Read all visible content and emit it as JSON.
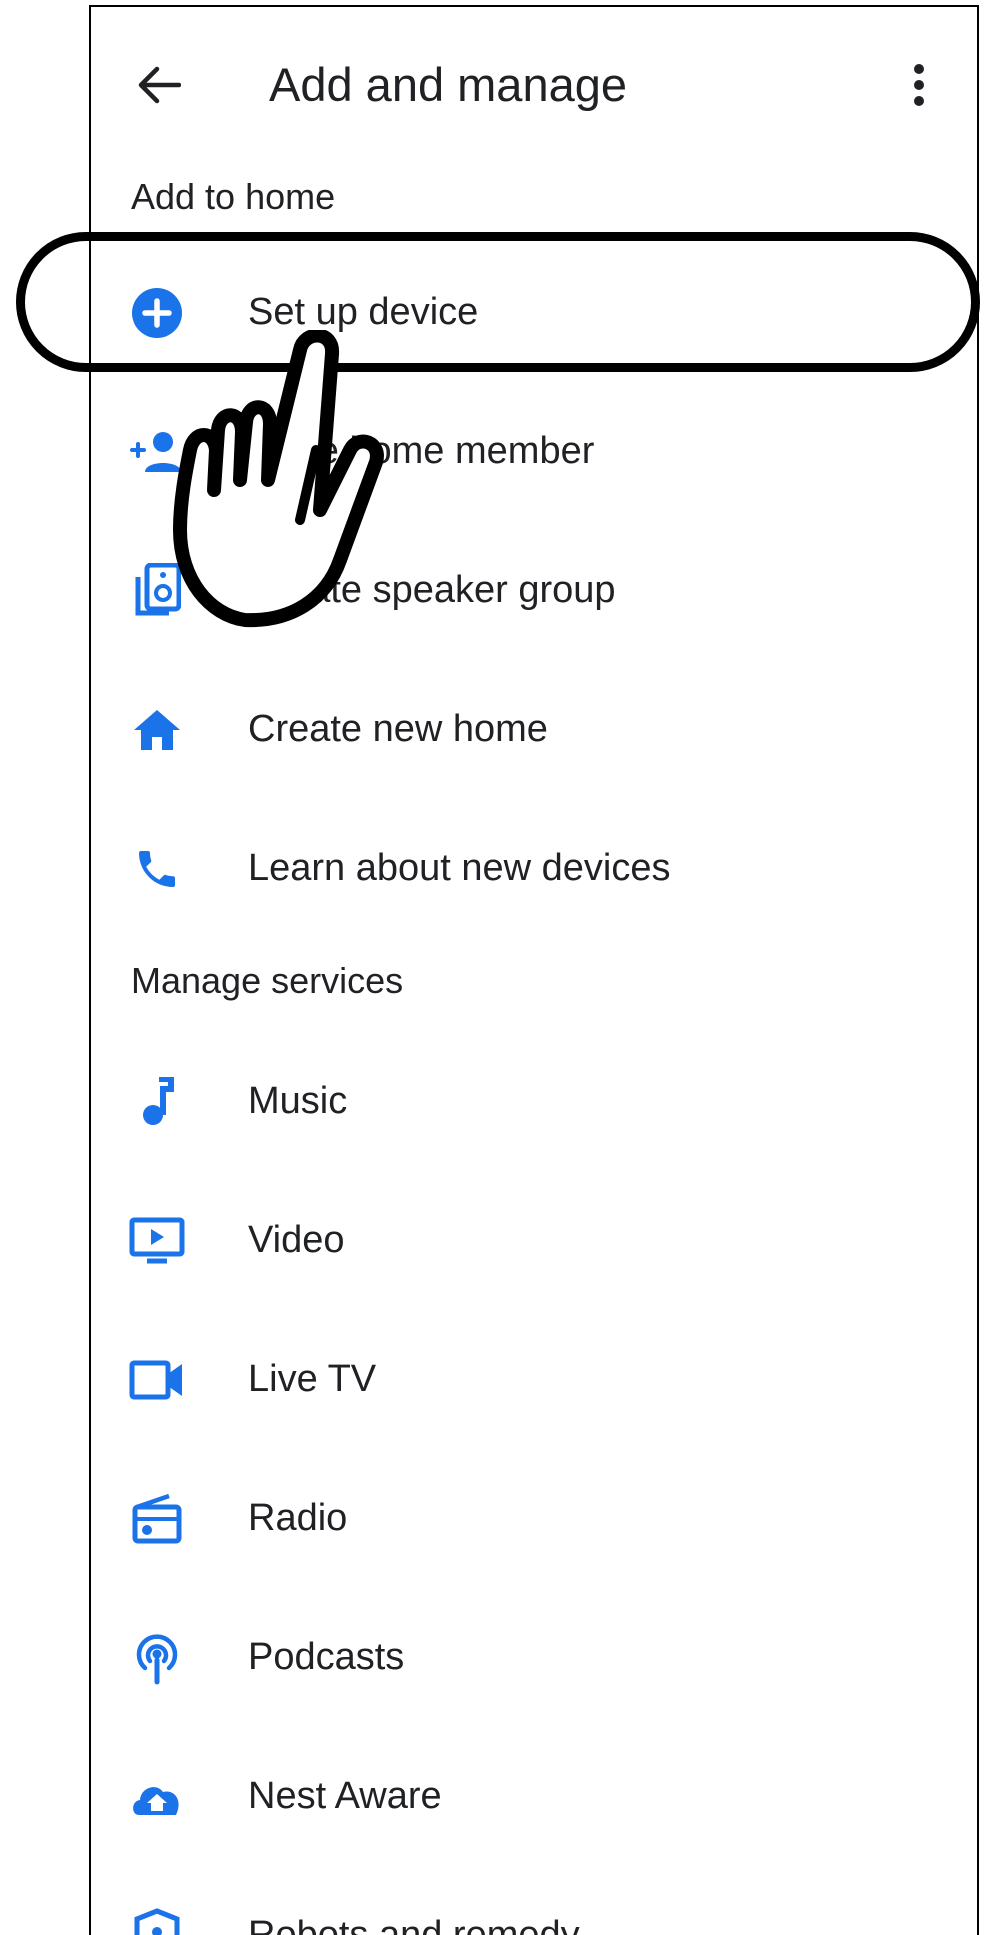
{
  "header": {
    "title": "Add and manage",
    "back_icon": "arrow-left-icon",
    "menu_icon": "more-vert-icon"
  },
  "sections": {
    "add_to_home": "Add to home",
    "manage_services": "Manage services"
  },
  "add_items": [
    {
      "label": "Set up device",
      "icon": "add-circle-icon"
    },
    {
      "label": "Invite home member",
      "icon": "person-add-icon"
    },
    {
      "label": "Create speaker group",
      "icon": "speaker-group-icon"
    },
    {
      "label": "Create new home",
      "icon": "home-icon"
    },
    {
      "label": "Learn about new devices",
      "icon": "phone-icon"
    }
  ],
  "service_items": [
    {
      "label": "Music",
      "icon": "music-note-icon"
    },
    {
      "label": "Video",
      "icon": "video-icon"
    },
    {
      "label": "Live TV",
      "icon": "videocam-icon"
    },
    {
      "label": "Radio",
      "icon": "radio-icon"
    },
    {
      "label": "Podcasts",
      "icon": "podcasts-icon"
    },
    {
      "label": "Nest Aware",
      "icon": "nest-aware-icon"
    },
    {
      "label": "Robots and remedy",
      "icon": "shield-icon"
    }
  ],
  "overlay": {
    "highlight": "set-up-device-highlight",
    "pointer_icon": "hand-pointer-icon"
  },
  "colors": {
    "accent": "#1a73e8",
    "text": "#202124",
    "outline": "#000000"
  }
}
